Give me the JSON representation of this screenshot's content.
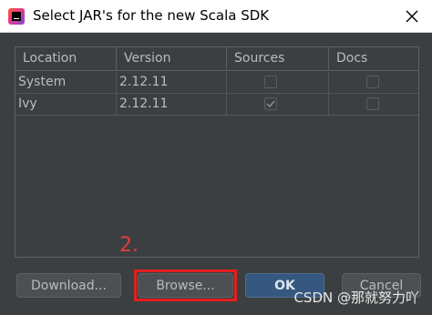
{
  "dialog": {
    "title": "Select JAR's for the new Scala SDK",
    "icon": "intellij-idea-icon"
  },
  "table": {
    "columns": [
      "Location",
      "Version",
      "Sources",
      "Docs"
    ],
    "rows": [
      {
        "location": "System",
        "version": "2.12.11",
        "sources": false,
        "docs": false
      },
      {
        "location": "Ivy",
        "version": "2.12.11",
        "sources": true,
        "docs": false
      }
    ]
  },
  "annotation": {
    "step_label": "2.",
    "highlight_color": "#e41e1e"
  },
  "buttons": {
    "download": "Download...",
    "browse": "Browse...",
    "ok": "OK",
    "cancel": "Cancel"
  },
  "watermark": "CSDN @那就努力吖",
  "colors": {
    "background": "#3c3f41",
    "ok_button": "#365880",
    "text": "#bbbbbb"
  }
}
